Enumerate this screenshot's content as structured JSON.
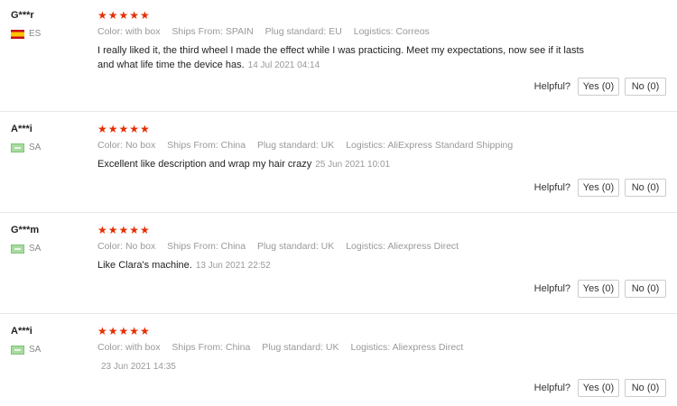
{
  "helpful_label": "Helpful?",
  "reviews": [
    {
      "user": "G***r",
      "country": "ES",
      "stars": "★★★★★",
      "color_label": "Color:",
      "color": "with box",
      "ships_label": "Ships From:",
      "ships": "SPAIN",
      "plug_label": "Plug standard:",
      "plug": "EU",
      "logistics_label": "Logistics:",
      "logistics": "Correos",
      "text": "I really liked it, the third wheel I made the effect while I was practicing. Meet my expectations, now see if it lasts and what life time the device has.",
      "date": "14 Jul 2021 04:14",
      "yes": "Yes (0)",
      "no": "No (0)"
    },
    {
      "user": "A***i",
      "country": "SA",
      "stars": "★★★★★",
      "color_label": "Color:",
      "color": "No box",
      "ships_label": "Ships From:",
      "ships": "China",
      "plug_label": "Plug standard:",
      "plug": "UK",
      "logistics_label": "Logistics:",
      "logistics": "AliExpress Standard Shipping",
      "text": "Excellent like description and wrap my hair crazy",
      "date": "25 Jun 2021 10:01",
      "yes": "Yes (0)",
      "no": "No (0)"
    },
    {
      "user": "G***m",
      "country": "SA",
      "stars": "★★★★★",
      "color_label": "Color:",
      "color": "No box",
      "ships_label": "Ships From:",
      "ships": "China",
      "plug_label": "Plug standard:",
      "plug": "UK",
      "logistics_label": "Logistics:",
      "logistics": "Aliexpress Direct",
      "text": "Like Clara's machine.",
      "date": "13 Jun 2021 22:52",
      "yes": "Yes (0)",
      "no": "No (0)"
    },
    {
      "user": "A***i",
      "country": "SA",
      "stars": "★★★★★",
      "color_label": "Color:",
      "color": "with box",
      "ships_label": "Ships From:",
      "ships": "China",
      "plug_label": "Plug standard:",
      "plug": "UK",
      "logistics_label": "Logistics:",
      "logistics": "Aliexpress Direct",
      "text": "",
      "date": "23 Jun 2021 14:35",
      "yes": "Yes (0)",
      "no": "No (0)"
    }
  ]
}
